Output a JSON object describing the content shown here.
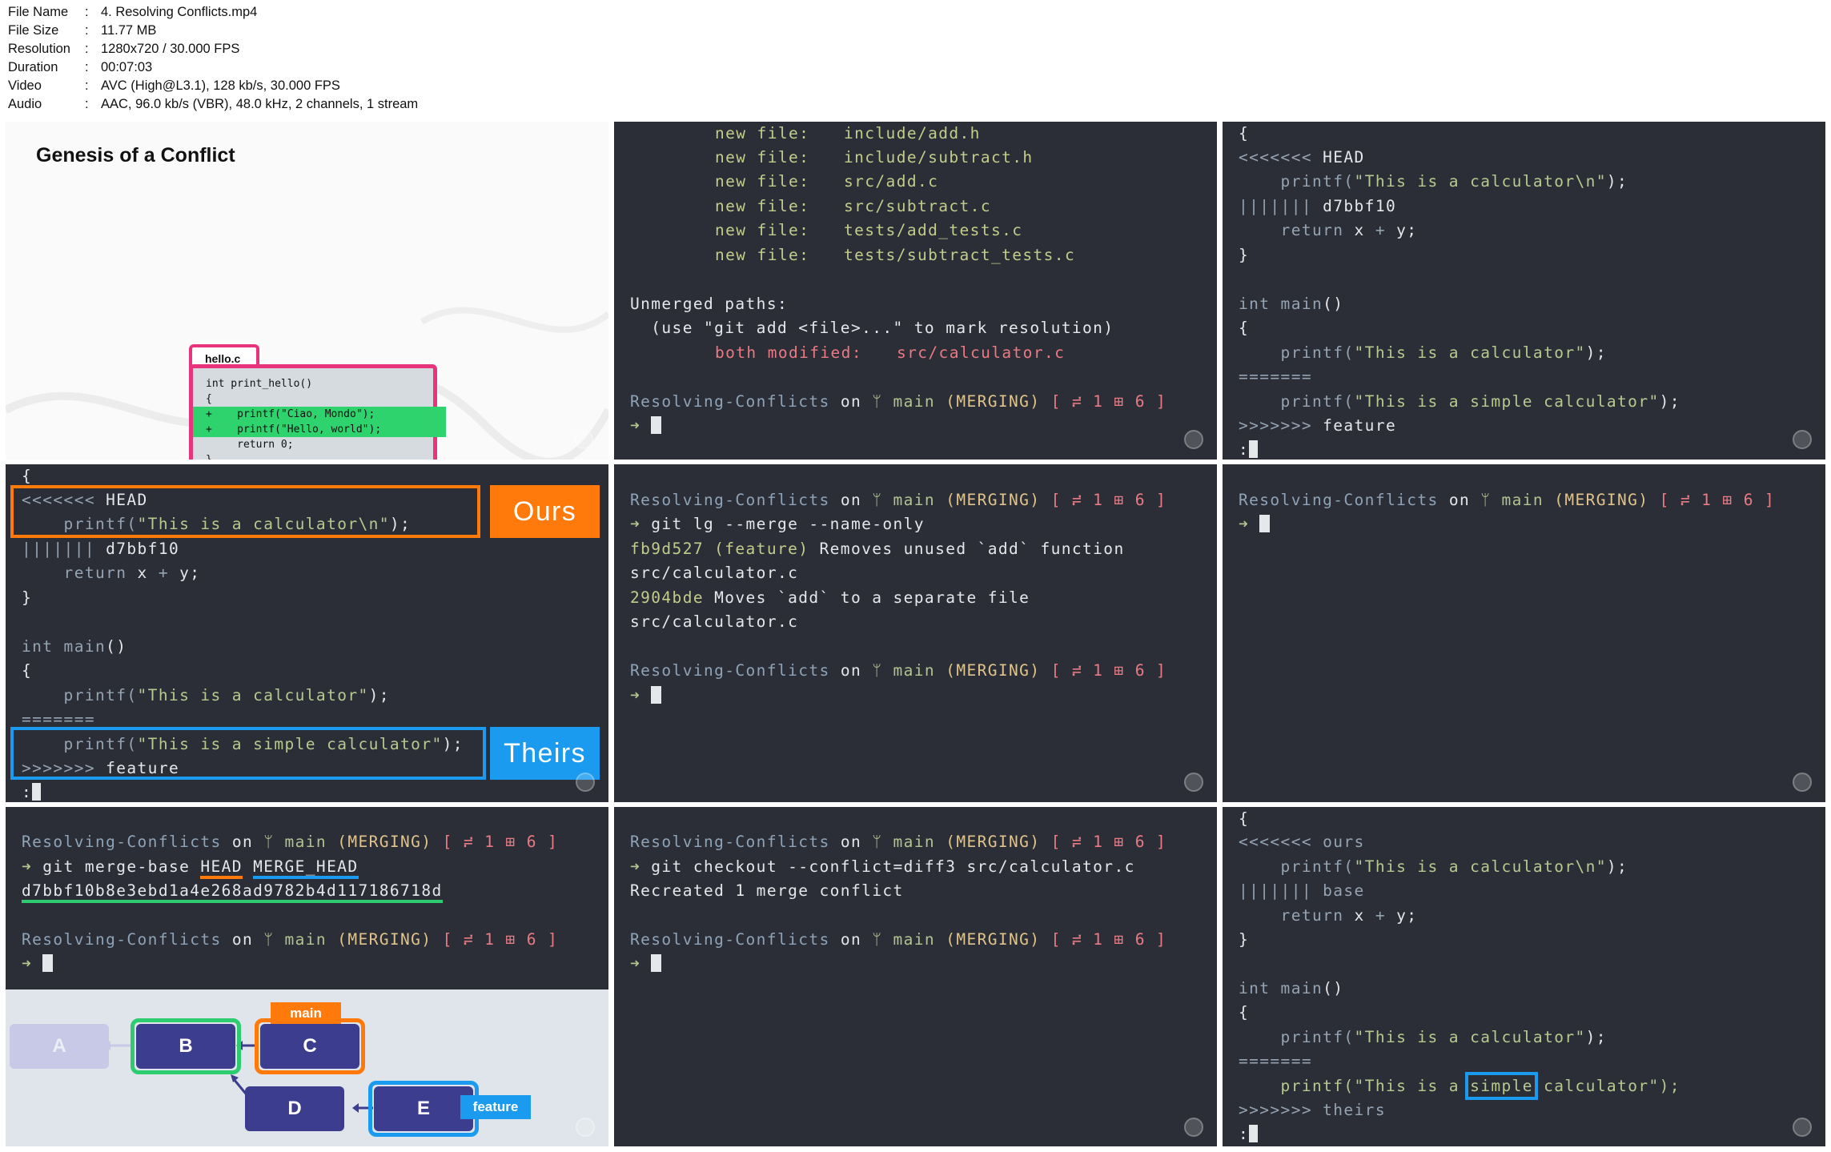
{
  "info": {
    "rows": [
      {
        "k": "File Name",
        "v": "4. Resolving Conflicts.mp4"
      },
      {
        "k": "File Size",
        "v": "11.77 MB"
      },
      {
        "k": "Resolution",
        "v": "1280x720 / 30.000 FPS"
      },
      {
        "k": "Duration",
        "v": "00:07:03"
      },
      {
        "k": "Video",
        "v": "AVC (High@L3.1), 128 kb/s, 30.000 FPS"
      },
      {
        "k": "Audio",
        "v": "AAC, 96.0 kb/s (VBR), 48.0 kHz, 2 channels, 1 stream"
      }
    ]
  },
  "prompt": {
    "dir": "Resolving-Conflicts",
    "on": "on",
    "branch_icon": "ᛘ",
    "branch": "main",
    "state": "(MERGING)",
    "status": "[ ≓ 1 ⊞ 6 ]",
    "arrow": "➜"
  },
  "t1": {
    "title": "Genesis of a Conflict",
    "file_tab": "hello.c",
    "code": [
      "int print_hello()",
      "{",
      "+    printf(\"Ciao, Mondo\");",
      "+    printf(\"Hello, world\");",
      "     return 0;",
      "}"
    ],
    "colors": {
      "accent": "#e8347b",
      "added": "#2ed36d"
    }
  },
  "t2": {
    "new_files": [
      {
        "label": "new file:",
        "path": "include/add.h"
      },
      {
        "label": "new file:",
        "path": "include/subtract.h"
      },
      {
        "label": "new file:",
        "path": "src/add.c"
      },
      {
        "label": "new file:",
        "path": "src/subtract.c"
      },
      {
        "label": "new file:",
        "path": "tests/add_tests.c"
      },
      {
        "label": "new file:",
        "path": "tests/subtract_tests.c"
      }
    ],
    "unmerged": "Unmerged paths:",
    "hint": "  (use \"git add <file>...\" to mark resolution)",
    "modified_label": "both modified:",
    "modified_path": "src/calculator.c"
  },
  "t3": {
    "l0": "{",
    "l1": "<<<<<<< HEAD",
    "l2a": "    printf(",
    "l2b": "\"This is a calculator\\n\"",
    "l2c": ");",
    "l3": "||||||| d7bbf10",
    "l4": "    return x + y;",
    "l5": "}",
    "l6": "int main()",
    "l7": "{",
    "l8a": "    printf(",
    "l8b": "\"This is a calculator\"",
    "l8c": ");",
    "l9": "=======",
    "l10a": "    printf(",
    "l10b": "\"This is a simple calculator\"",
    "l10c": ");",
    "l11": ">>>>>>> feature",
    "l12": ":"
  },
  "t4": {
    "ours": "Ours",
    "theirs": "Theirs",
    "colors": {
      "ours": "#ff7a0a",
      "theirs": "#1a9bf0"
    }
  },
  "t5": {
    "cmd": "git lg --merge --name-only",
    "c1_hash": "fb9d527",
    "c1_ref": "(feature)",
    "c1_msg": "Removes unused `add` function",
    "c1_file": "src/calculator.c",
    "c2_hash": "2904bde",
    "c2_msg": "Moves `add` to a separate file",
    "c2_file": "src/calculator.c"
  },
  "t7": {
    "cmd_a": "git merge-base ",
    "cmd_b": "HEAD",
    "cmd_c": " ",
    "cmd_d": "MERGE_HEAD",
    "hash": "d7bbf10b8e3ebd1a4e268ad9782b4d117186718d",
    "nodes": {
      "a": "A",
      "b": "B",
      "c": "C",
      "d": "D",
      "e": "E"
    },
    "tags": {
      "main": "main",
      "feature": "feature"
    },
    "colors": {
      "head": "#ff7a0a",
      "merge_head": "#1a9bf0",
      "hash": "#2ecc71",
      "node": "#3d3d8f"
    }
  },
  "t8": {
    "cmd": "git checkout --conflict=diff3 src/calculator.c",
    "out": "Recreated 1 merge conflict"
  },
  "t9": {
    "l0": "{",
    "l1": "<<<<<<< ours",
    "l3": "||||||| base",
    "l11": ">>>>>>> theirs",
    "l10a": "    printf(\"This is a ",
    "l10b": "simple",
    "l10c": " calculator\");"
  }
}
